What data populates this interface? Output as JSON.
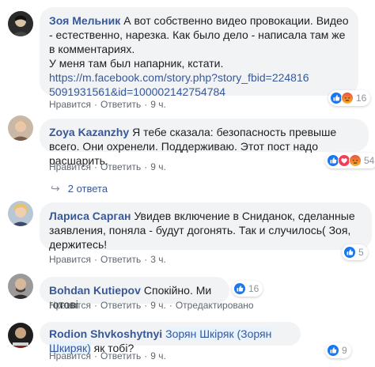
{
  "comments": [
    {
      "name": "Зоя Мельник",
      "text": "А вот собственно видео провокации. Видео - естественно, нарезка. Как было дело - написала там же в комментариях.",
      "text2": "У меня там был напарник, кстати.",
      "link": "https://m.facebook.com/story.php?story_fbid=2248165091931561&id=100002142754784",
      "like": "Нравится",
      "reply": "Ответить",
      "time": "9 ч.",
      "reaction_count": "16"
    },
    {
      "name": "Zoya Kazanzhy",
      "text": "Я тебе сказала: безопасность превыше всего. Они охренели. Поддерживаю. Этот пост надо расшарить.",
      "like": "Нравится",
      "reply": "Ответить",
      "time": "9 ч.",
      "reaction_count": "54",
      "replies_label": "2 ответа"
    },
    {
      "name": "Лариса Сарган",
      "text": "Увидев включение в Сниданок, сделанные заявления, поняла - будут догонять. Так и случилось( Зоя, держитесь!",
      "like": "Нравится",
      "reply": "Ответить",
      "time": "3 ч.",
      "reaction_count": "5"
    },
    {
      "name": "Bohdan Kutiepov",
      "text": "Спокійно. Ми готові",
      "like": "Нравится",
      "reply": "Ответить",
      "time": "9 ч.",
      "edited": "Отредактировано",
      "reaction_count": "16"
    },
    {
      "name": "Rodion Shvkoshytnyi",
      "tag": "Зорян Шкіряк (Зорян Шкиряк)",
      "text": "як тобі?",
      "like": "Нравится",
      "reply": "Ответить",
      "time": "9 ч.",
      "reaction_count": "9"
    }
  ],
  "colors": {
    "link": "#385898",
    "bubble": "#f2f3f5",
    "like_blue": "#1877f2",
    "love_red": "#f33e58",
    "muted": "#606770"
  },
  "icons": [
    "like-icon",
    "love-icon",
    "angry-icon",
    "reply-arrow-icon"
  ]
}
